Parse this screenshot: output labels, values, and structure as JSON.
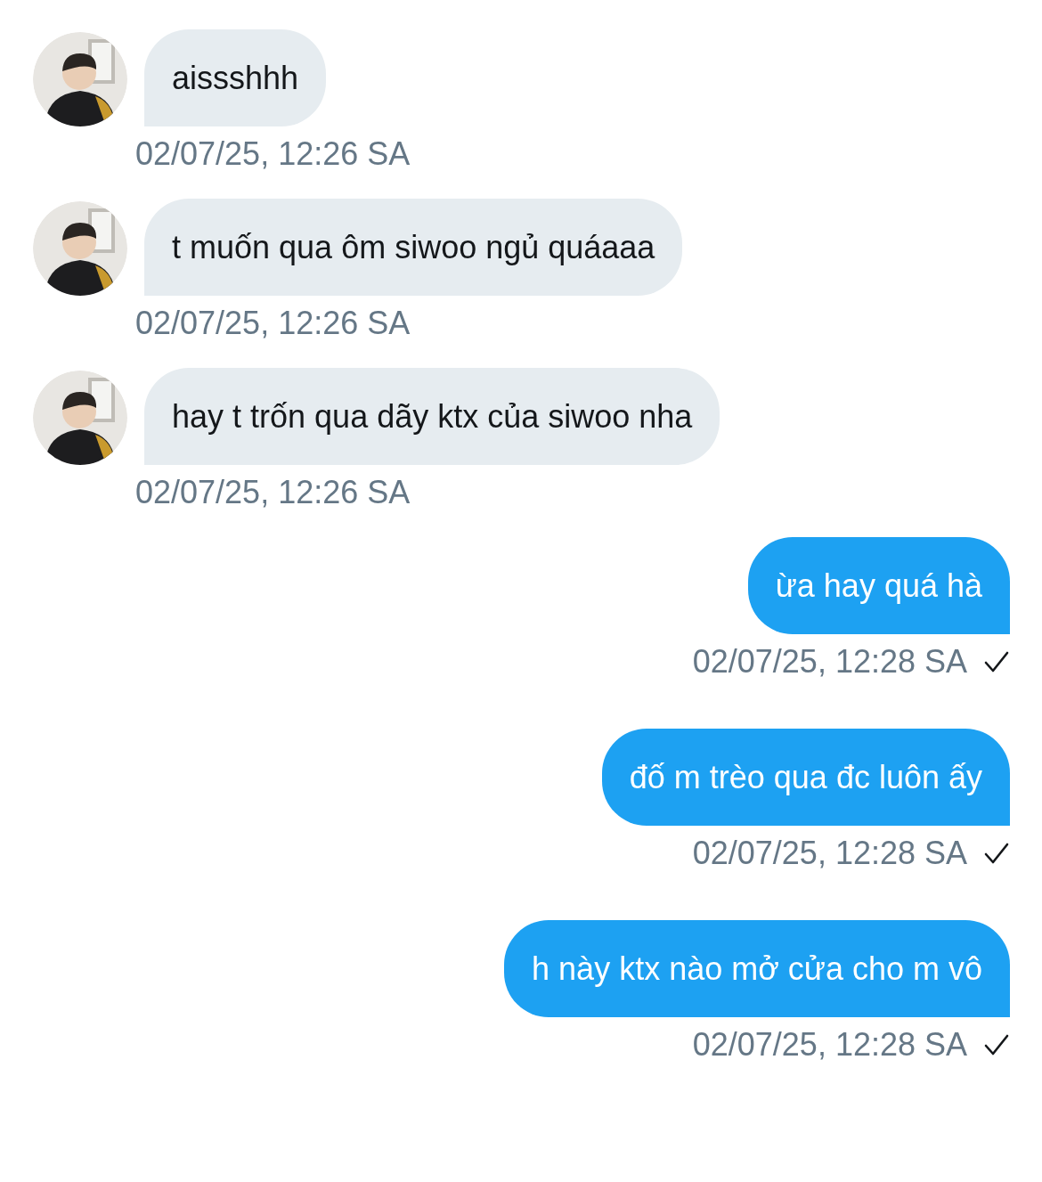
{
  "messages": [
    {
      "kind": "received",
      "text": "aissshhh",
      "time": "02/07/25, 12:26 SA"
    },
    {
      "kind": "received",
      "text": "t muốn qua ôm siwoo ngủ quáaaa",
      "time": "02/07/25, 12:26 SA"
    },
    {
      "kind": "received",
      "text": "hay t trốn qua dãy ktx của siwoo nha",
      "time": "02/07/25, 12:26 SA"
    },
    {
      "kind": "sent",
      "text": "ừa hay quá hà",
      "time": "02/07/25, 12:28 SA"
    },
    {
      "kind": "sent",
      "text": "đố m trèo qua đc luôn ấy",
      "time": "02/07/25, 12:28 SA"
    },
    {
      "kind": "sent",
      "text": "h này ktx nào mở cửa cho m vô",
      "time": "02/07/25, 12:28 SA"
    }
  ]
}
